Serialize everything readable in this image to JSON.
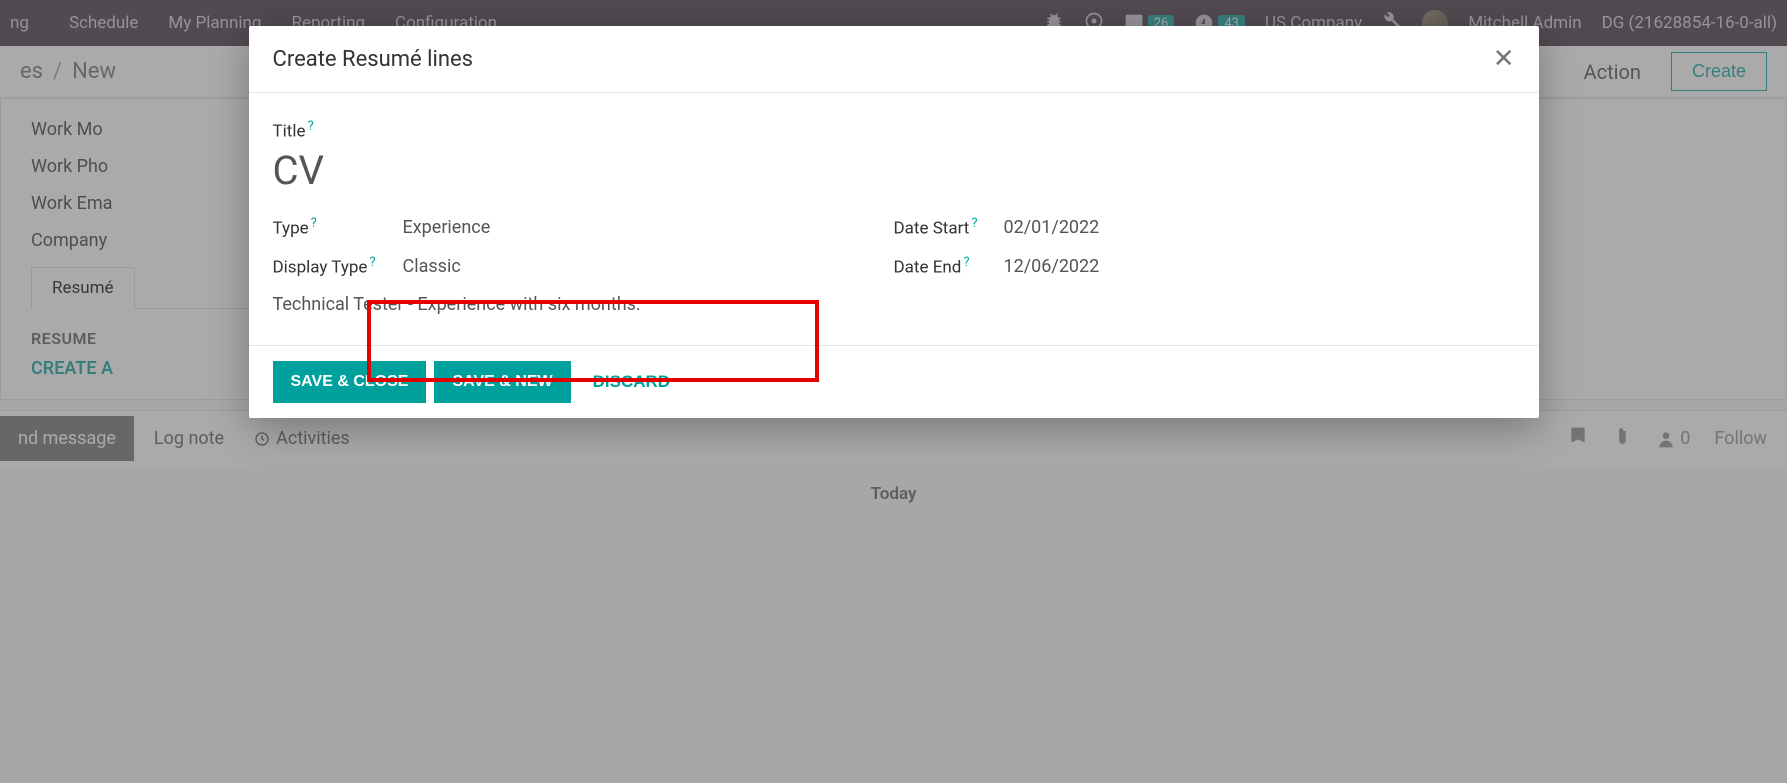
{
  "topnav": {
    "left_item": "ng",
    "menu": [
      "Schedule",
      "My Planning",
      "Reporting",
      "Configuration"
    ],
    "msg_badge": "26",
    "clock_badge": "43",
    "company": "US Company",
    "user": "Mitchell Admin",
    "db": "DG (21628854-16-0-all)"
  },
  "breadcrumb": {
    "crumb1": "es",
    "crumb2": "New",
    "action": "Action",
    "create": "Create"
  },
  "form": {
    "work_mobile": "Work Mo",
    "work_phone": "Work Pho",
    "work_email": "Work Ema",
    "company": "Company",
    "tab_resume": "Resumé",
    "resume_heading": "RESUME",
    "create_entry": "CREATE A"
  },
  "chatter": {
    "send": "nd message",
    "log_note": "Log note",
    "activities": "Activities",
    "follower_count": "0",
    "follow": "Follow",
    "today": "Today"
  },
  "modal": {
    "title": "Create Resumé lines",
    "title_label": "Title",
    "title_value": "CV",
    "type_label": "Type",
    "type_value": "Experience",
    "display_type_label": "Display Type",
    "display_type_value": "Classic",
    "date_start_label": "Date Start",
    "date_start_value": "02/01/2022",
    "date_end_label": "Date End",
    "date_end_value": "12/06/2022",
    "description": "Technical Tester - Experience with six months.",
    "save_close": "SAVE & CLOSE",
    "save_new": "SAVE & NEW",
    "discard": "DISCARD"
  }
}
